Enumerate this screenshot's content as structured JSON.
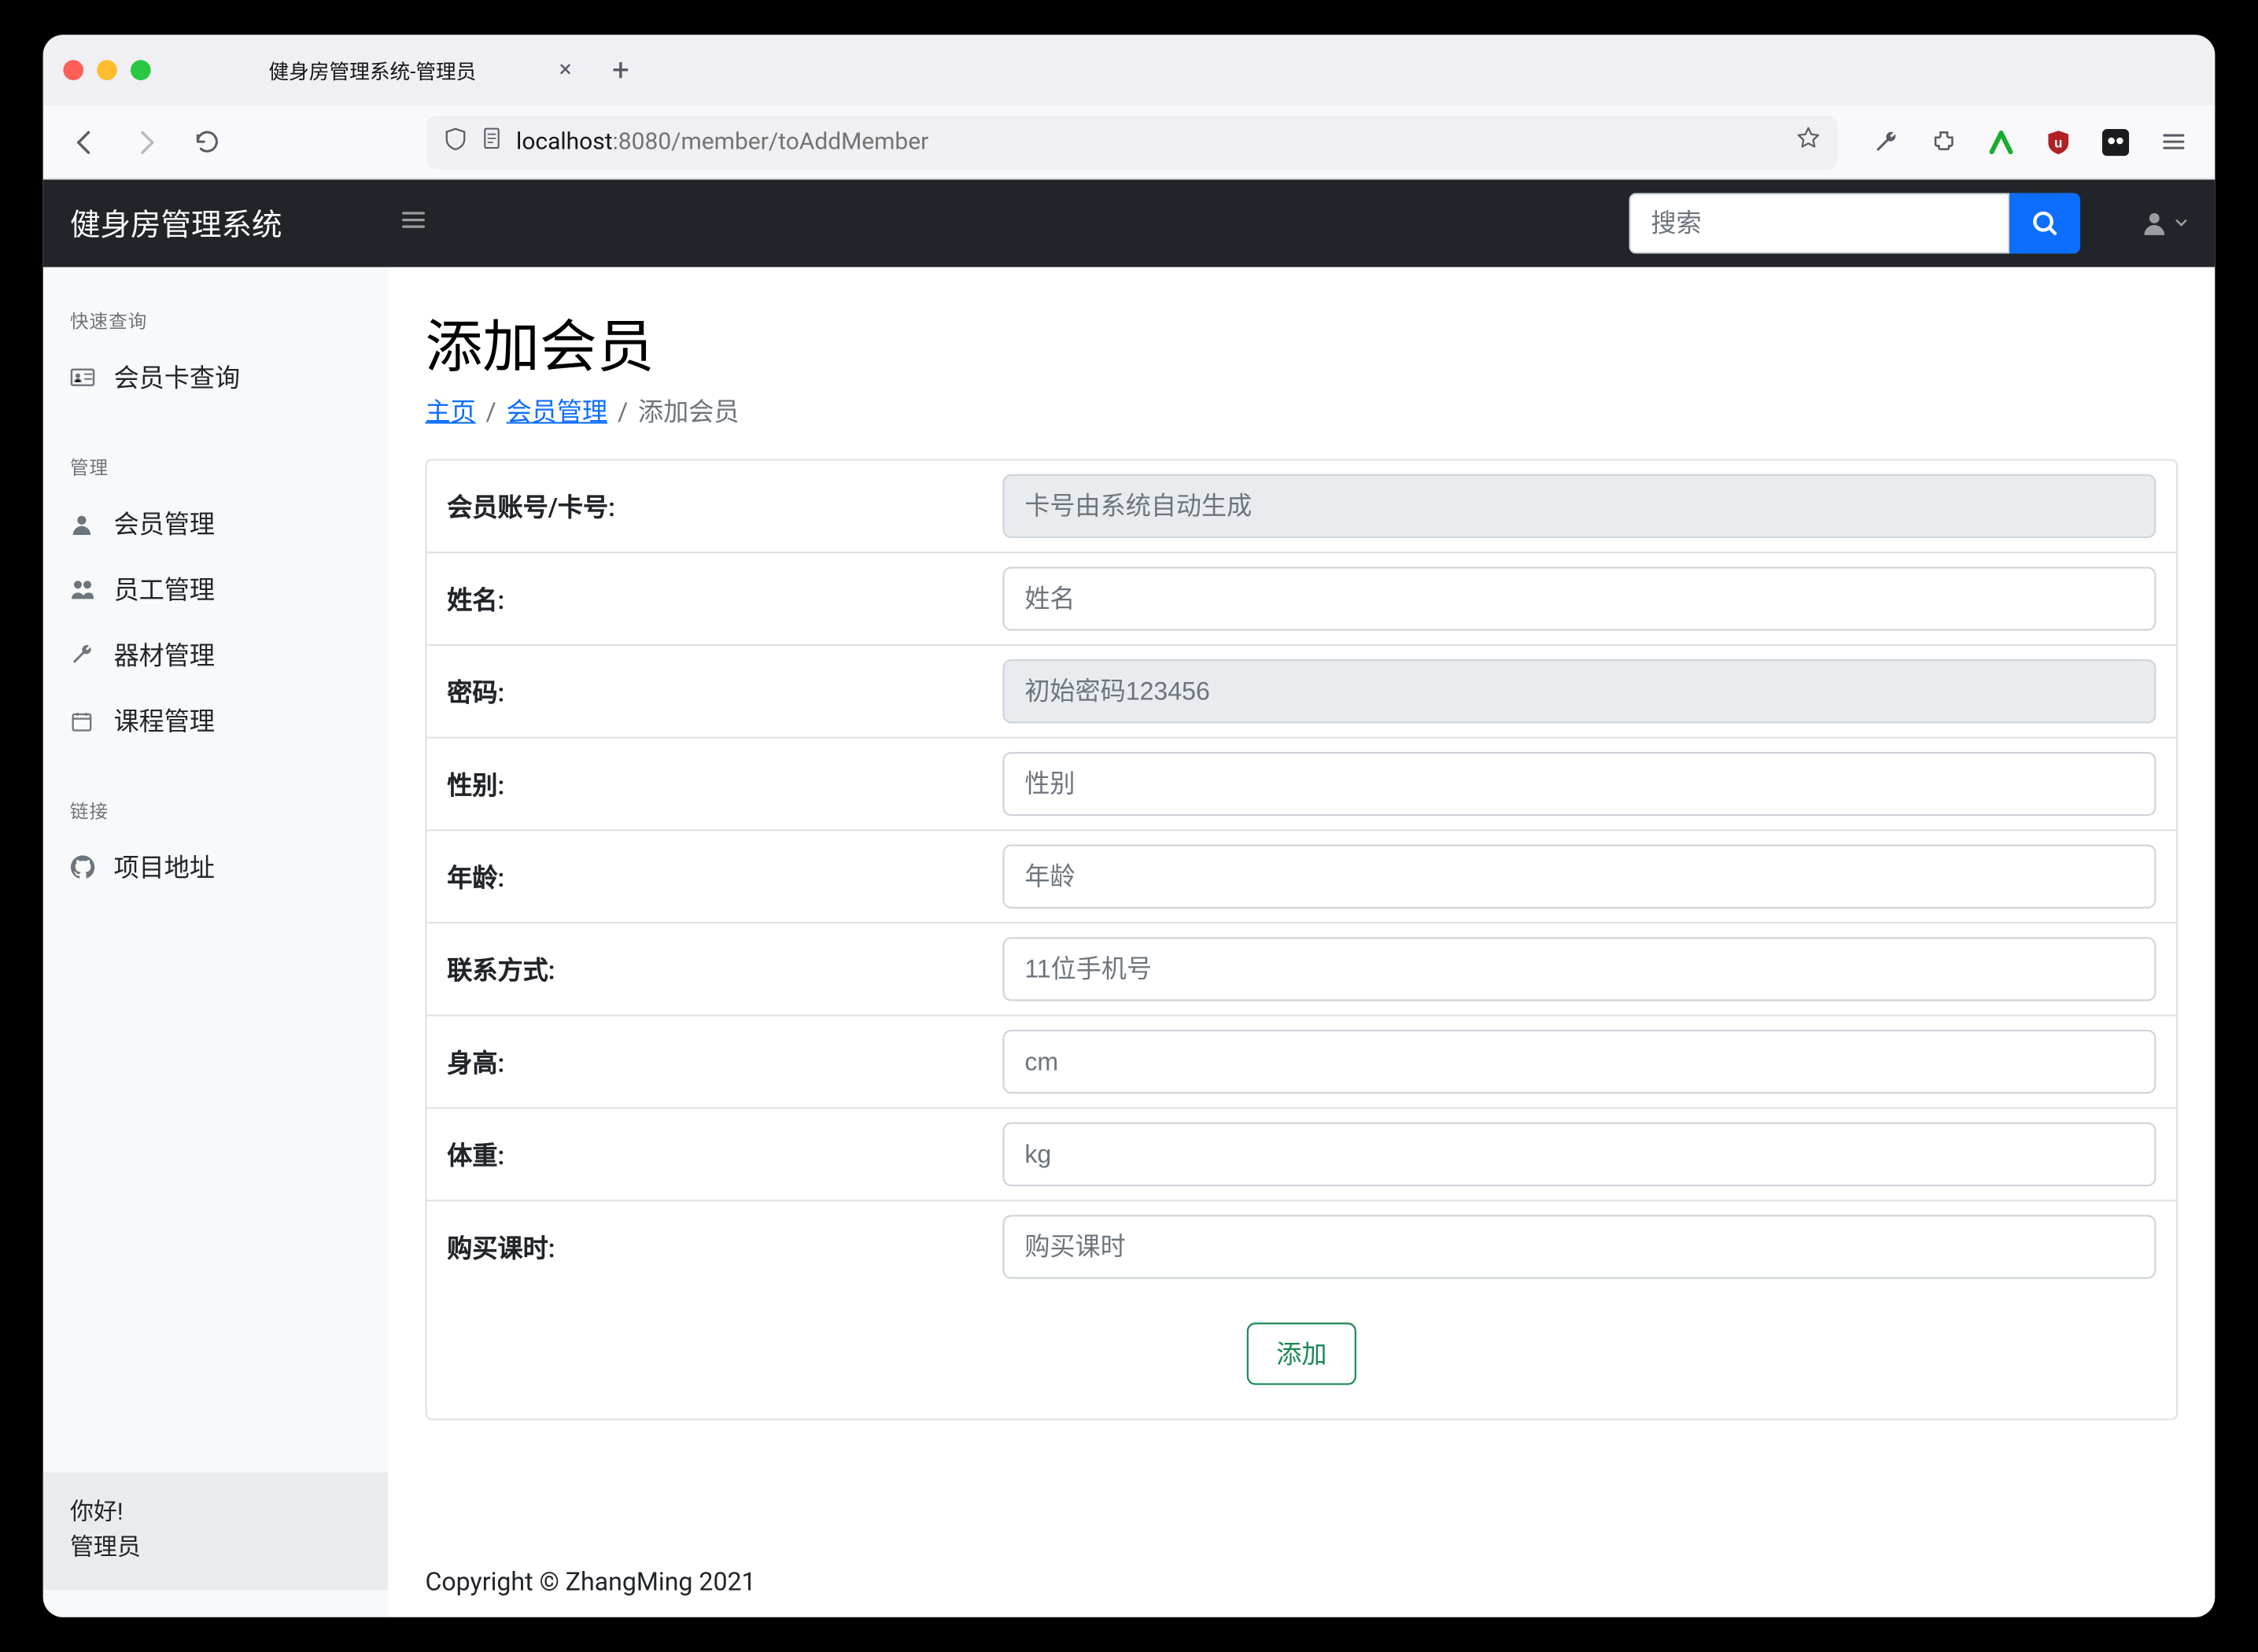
{
  "browser": {
    "tab_title": "健身房管理系统-管理员",
    "url_host": "localhost",
    "url_port_path": ":8080/member/toAddMember"
  },
  "topnav": {
    "brand": "健身房管理系统",
    "search_placeholder": "搜索"
  },
  "sidebar": {
    "sections": [
      {
        "heading": "快速查询",
        "items": [
          {
            "label": "会员卡查询",
            "icon": "id-card"
          }
        ]
      },
      {
        "heading": "管理",
        "items": [
          {
            "label": "会员管理",
            "icon": "user"
          },
          {
            "label": "员工管理",
            "icon": "users"
          },
          {
            "label": "器材管理",
            "icon": "wrench"
          },
          {
            "label": "课程管理",
            "icon": "calendar"
          }
        ]
      },
      {
        "heading": "链接",
        "items": [
          {
            "label": "项目地址",
            "icon": "github"
          }
        ]
      }
    ],
    "footer_greeting": "你好!",
    "footer_role": "管理员"
  },
  "page": {
    "title": "添加会员",
    "breadcrumb": [
      {
        "label": "主页",
        "link": true
      },
      {
        "label": "会员管理",
        "link": true
      },
      {
        "label": "添加会员",
        "link": false
      }
    ]
  },
  "form": {
    "fields": [
      {
        "label": "会员账号/卡号",
        "placeholder": "卡号由系统自动生成",
        "disabled": true
      },
      {
        "label": "姓名",
        "placeholder": "姓名",
        "disabled": false
      },
      {
        "label": "密码",
        "placeholder": "初始密码123456",
        "disabled": true
      },
      {
        "label": "性别",
        "placeholder": "性别",
        "disabled": false
      },
      {
        "label": "年龄",
        "placeholder": "年龄",
        "disabled": false
      },
      {
        "label": "联系方式",
        "placeholder": "11位手机号",
        "disabled": false
      },
      {
        "label": "身高",
        "placeholder": "cm",
        "disabled": false
      },
      {
        "label": "体重",
        "placeholder": "kg",
        "disabled": false
      },
      {
        "label": "购买课时",
        "placeholder": "购买课时",
        "disabled": false
      }
    ],
    "submit_label": "添加"
  },
  "footer": {
    "copyright": "Copyright © ZhangMing 2021"
  }
}
